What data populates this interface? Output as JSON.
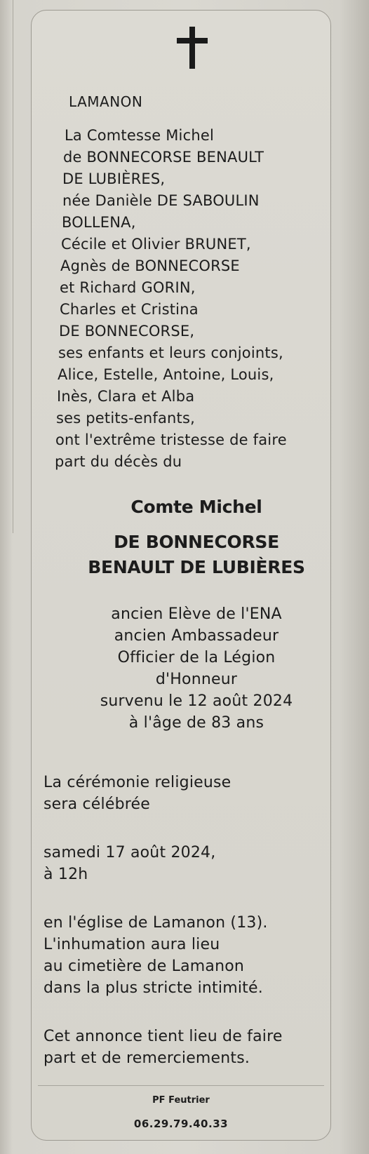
{
  "notice": {
    "place": "LAMANON",
    "family_lines": [
      "La Comtesse Michel",
      "de BONNECORSE BENAULT",
      "DE LUBIÈRES,",
      "née Danièle DE SABOULIN",
      "BOLLENA,",
      "Cécile et Olivier BRUNET,",
      "Agnès de BONNECORSE",
      "et Richard GORIN,",
      "Charles et Cristina",
      "DE BONNECORSE,",
      "ses enfants et leurs conjoints,",
      "Alice, Estelle, Antoine, Louis,",
      "Inès, Clara et Alba",
      "ses petits-enfants,",
      "ont l'extrême tristesse de faire",
      "part du décès du"
    ],
    "deceased": {
      "title_line": "Comte Michel",
      "name_line_1": "DE BONNECORSE",
      "name_line_2": "BENAULT DE LUBIÈRES"
    },
    "titles": [
      "ancien Elève de l'ENA",
      "ancien Ambassadeur",
      "Officier de la Légion",
      "d'Honneur",
      "survenu le 12 août 2024",
      "à l'âge de 83 ans"
    ],
    "ceremony": [
      "La cérémonie religieuse",
      "sera célébrée"
    ],
    "date": [
      "samedi 17 août 2024,",
      "à 12h"
    ],
    "location": [
      "en l'église de Lamanon (13).",
      "L'inhumation aura lieu",
      "au cimetière de Lamanon",
      "dans la plus stricte intimité."
    ],
    "closing": [
      "Cet annonce tient lieu de faire",
      "part et de remerciements."
    ],
    "footer": {
      "agency": "PF Feutrier",
      "phone": "06.29.79.40.33"
    }
  }
}
